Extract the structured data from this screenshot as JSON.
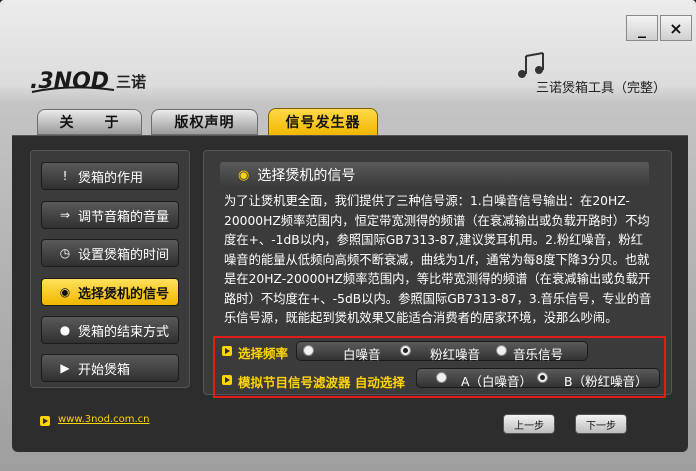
{
  "window": {
    "minimize_label": "_",
    "close_label": "×"
  },
  "brand": {
    "logo_text": ".3NOD",
    "logo_cn": "三诺",
    "tool_title": "三诺煲箱工具（完整）"
  },
  "tabs": [
    {
      "label": "关　　于"
    },
    {
      "label": "版权声明"
    },
    {
      "label": "信号发生器"
    }
  ],
  "sidebar": {
    "items": [
      {
        "label": "煲箱的作用",
        "icon": "exclamation-icon"
      },
      {
        "label": "调节音箱的音量",
        "icon": "volume-arrow-icon"
      },
      {
        "label": "设置煲箱的时间",
        "icon": "clock-icon"
      },
      {
        "label": "选择煲机的信号",
        "icon": "signal-icon"
      },
      {
        "label": "煲箱的结束方式",
        "icon": "stop-icon"
      },
      {
        "label": "开始煲箱",
        "icon": "play-icon"
      }
    ]
  },
  "content": {
    "header": "选择煲机的信号",
    "description": "为了让煲机更全面，我们提供了三种信号源：1.白噪音信号输出：在20HZ-20000HZ频率范围内，恒定带宽测得的频谱（在衰减输出或负载开路时）不均度在+、-1dB以内，参照国际GB7313-87,建议煲耳机用。2.粉红噪音，粉红噪音的能量从低频向高频不断衰减，曲线为1/f，通常为每8度下降3分贝。也就是在20HZ-20000HZ频率范围内，等比带宽测得的频谱（在衰减输出或负载开路时）不均度在+、-5dB以内。参照国际GB7313-87，3.音乐信号，专业的音乐信号源，既能起到煲机效果又能适合消费者的居家环境，没那么吵闹。"
  },
  "frequency": {
    "label": "选择频率",
    "options": [
      {
        "label": "白噪音",
        "selected": false
      },
      {
        "label": "粉红噪音",
        "selected": true
      },
      {
        "label": "音乐信号",
        "selected": false
      }
    ]
  },
  "filter": {
    "label": "模拟节目信号滤波器 自动选择",
    "options": [
      {
        "label": "A（白噪音）",
        "selected": false
      },
      {
        "label": "B（粉红噪音）",
        "selected": true
      }
    ]
  },
  "footer": {
    "website": "www.3nod.com.cn",
    "prev_label": "上一步",
    "next_label": "下一步"
  },
  "colors": {
    "accent": "#ffd400",
    "active_tab": "#f2b800",
    "highlight_border": "#e31b1b",
    "panel": "#2d2d2d"
  }
}
